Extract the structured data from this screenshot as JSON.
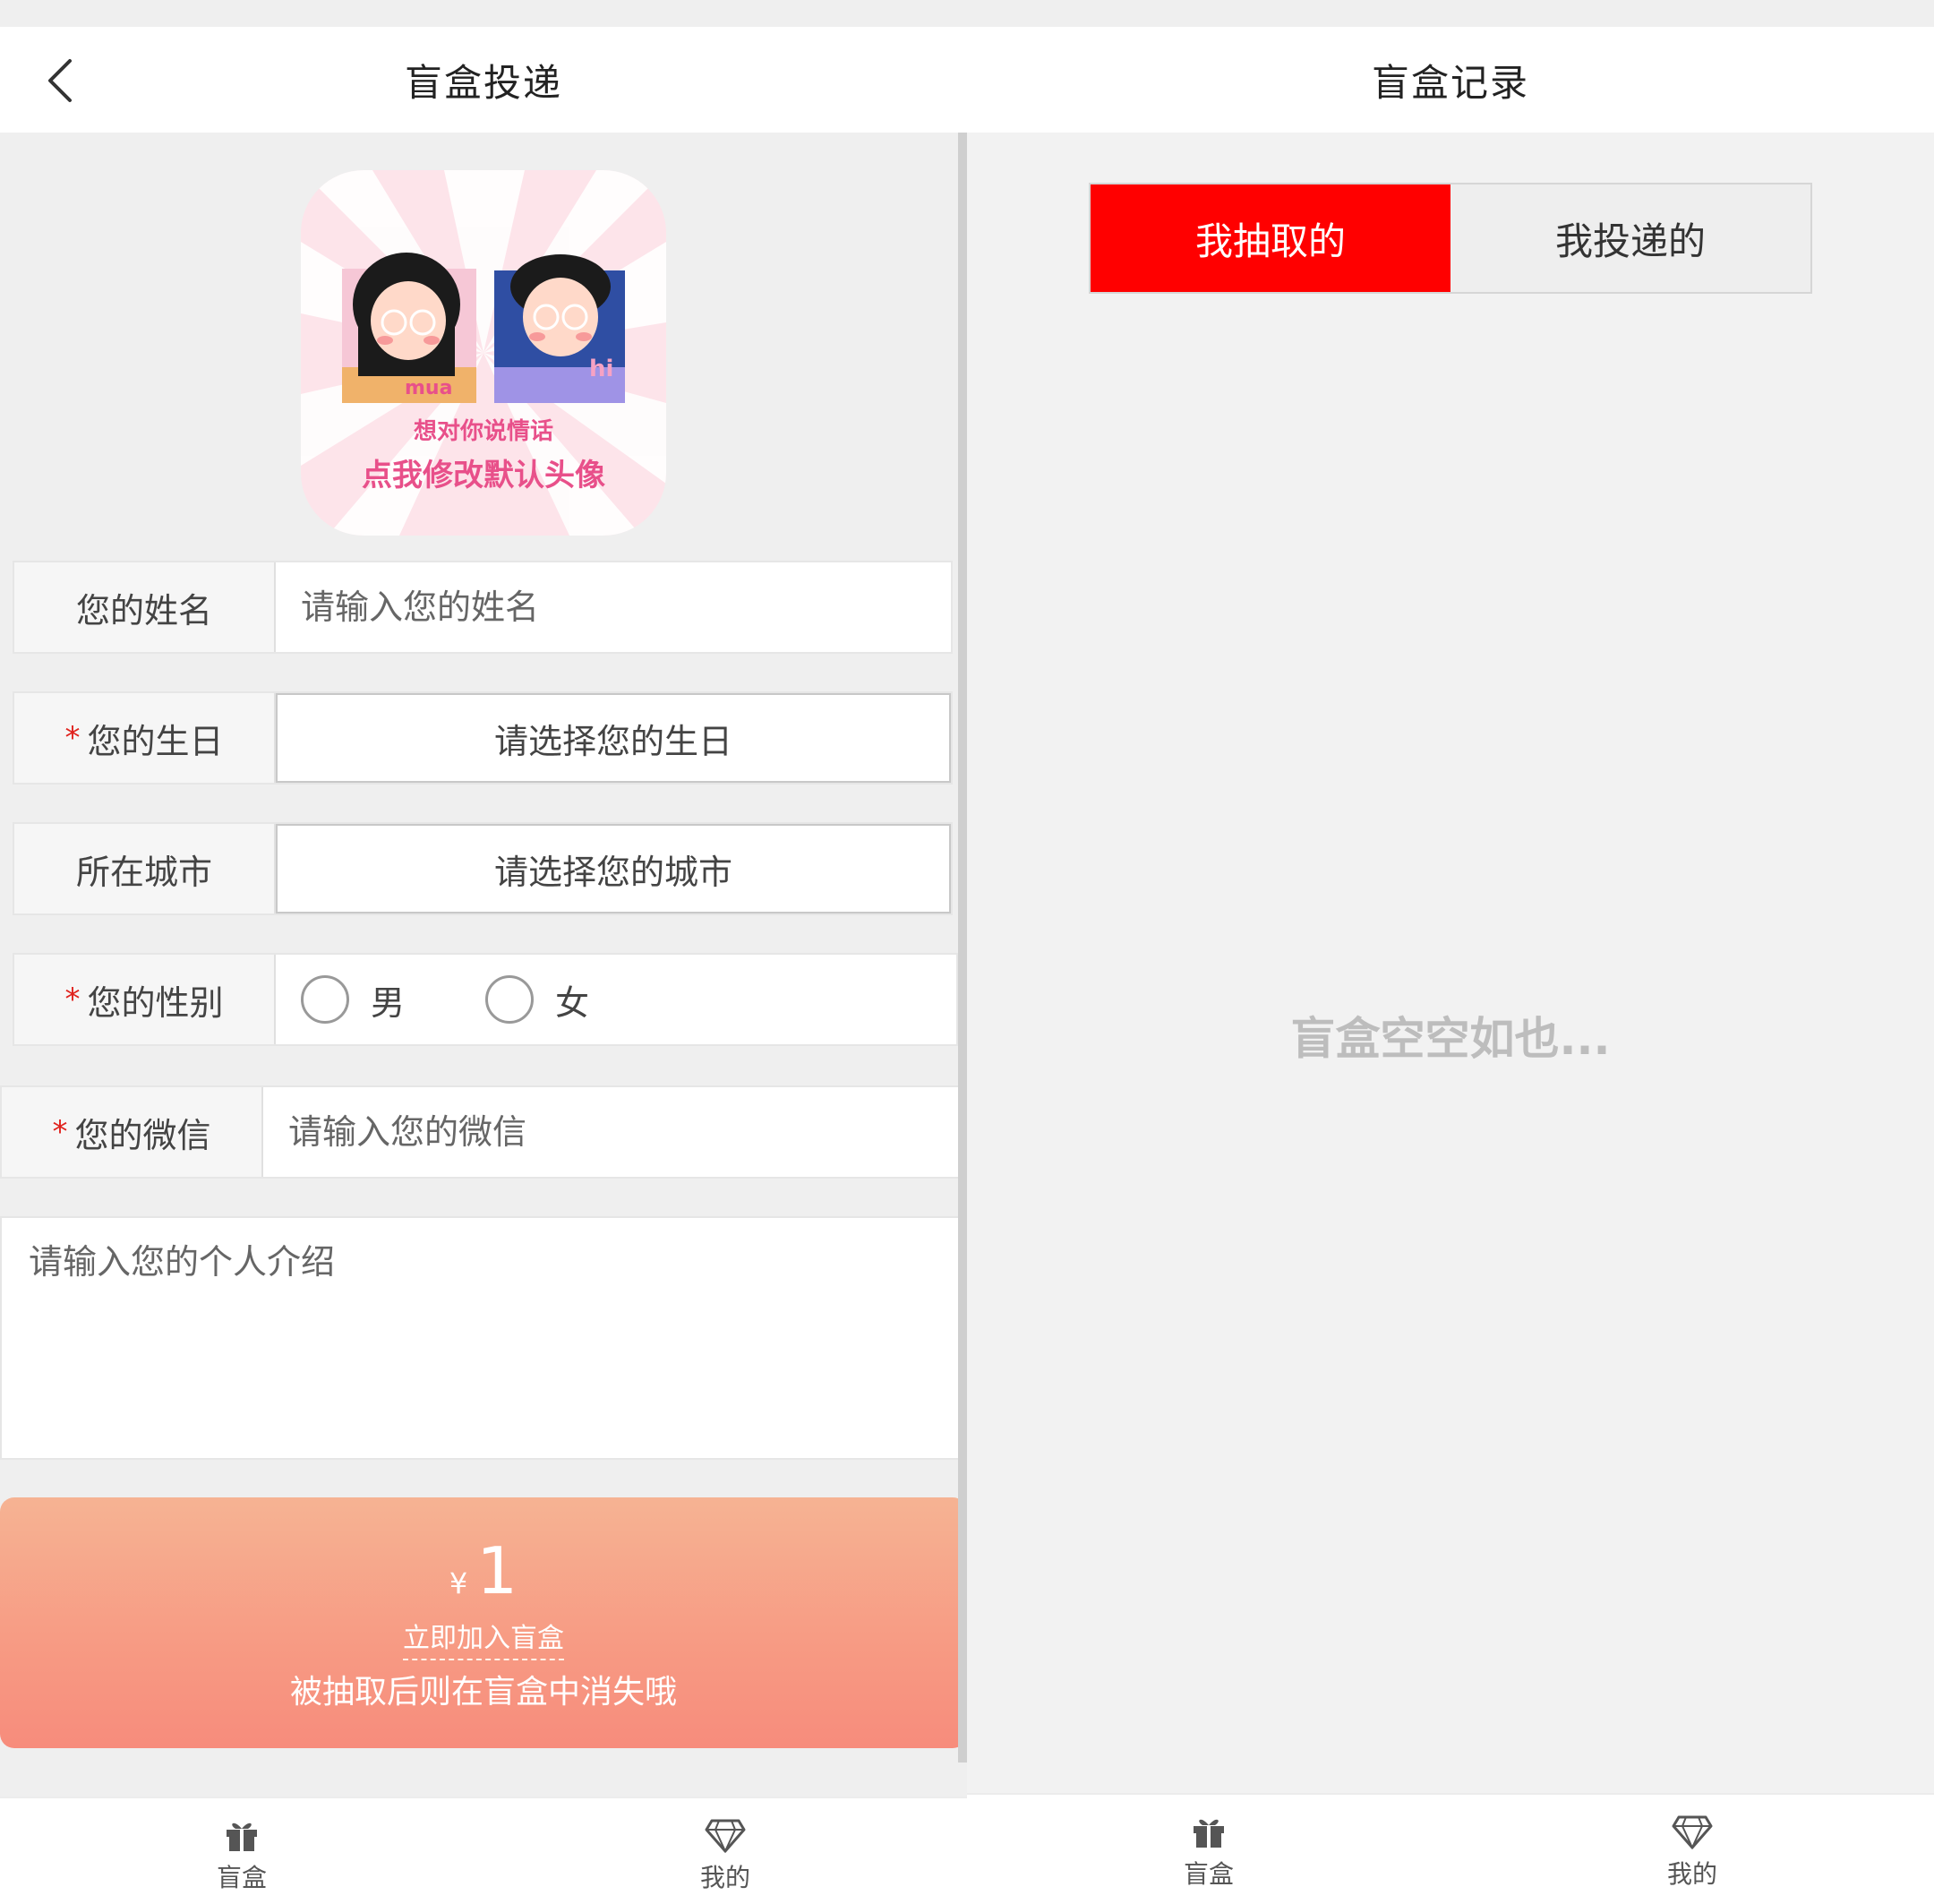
{
  "left": {
    "header": {
      "title": "盲盒投递"
    },
    "avatar": {
      "line1": "想对你说情话",
      "line2": "点我修改默认头像",
      "tag_left": "mua",
      "tag_right": "hi"
    },
    "form": {
      "name": {
        "label": "您的姓名",
        "placeholder": "请输入您的姓名",
        "required": false
      },
      "birthday": {
        "label": "您的生日",
        "value": "请选择您的生日",
        "required": true
      },
      "city": {
        "label": "所在城市",
        "value": "请选择您的城市",
        "required": false
      },
      "gender": {
        "label": "您的性别",
        "required": true,
        "options": [
          "男",
          "女"
        ]
      },
      "wechat": {
        "label": "您的微信",
        "placeholder": "请输入您的微信",
        "required": true
      },
      "intro": {
        "placeholder": "请输入您的个人介绍"
      },
      "required_mark": "*"
    },
    "pay": {
      "currency": "¥",
      "amount": "1",
      "action": "立即加入盲盒",
      "note": "被抽取后则在盲盒中消失哦"
    },
    "tabbar": [
      {
        "label": "盲盒",
        "icon": "gift-icon"
      },
      {
        "label": "我的",
        "icon": "diamond-icon"
      }
    ]
  },
  "right": {
    "header": {
      "title": "盲盒记录"
    },
    "segments": [
      {
        "label": "我抽取的",
        "active": true
      },
      {
        "label": "我投递的",
        "active": false
      }
    ],
    "empty_text": "盲盒空空如也...",
    "tabbar": [
      {
        "label": "盲盒",
        "icon": "gift-icon"
      },
      {
        "label": "我的",
        "icon": "diamond-icon"
      }
    ]
  },
  "colors": {
    "accent_red": "#ff0000",
    "pay_gradient_top": "#f6b393",
    "pay_gradient_bottom": "#f78c7c",
    "required_star": "#e0221d"
  }
}
